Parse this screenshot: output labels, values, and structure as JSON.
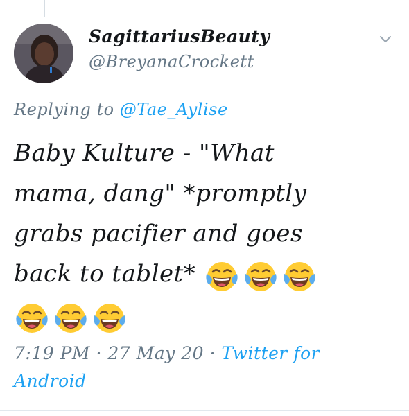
{
  "tweet": {
    "display_name": "SagittariusBeauty",
    "handle": "@BreyanaCrockett",
    "reply_prefix": "Replying to ",
    "reply_to": "@Tae_Aylise",
    "text_line1": "Baby Kulture - \"What",
    "text_line2": "mama, dang\" *promptly",
    "text_line3": "grabs pacifier and goes",
    "text_line4": "back to tablet*",
    "emoji": "face-with-tears-of-joy-icon",
    "emoji_count": 6,
    "time": "7:19 PM",
    "separator": " · ",
    "date": "27 May 20",
    "source": "Twitter for Android"
  },
  "colors": {
    "text": "#14171a",
    "secondary": "#657786",
    "link": "#1da1f2",
    "emoji_face": "#ffcc33",
    "emoji_tears": "#5dadec"
  }
}
